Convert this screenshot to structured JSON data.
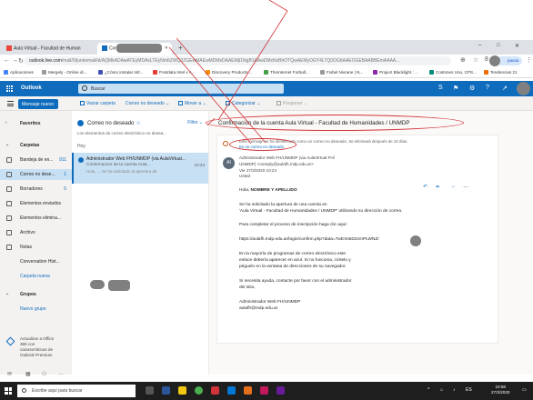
{
  "browser": {
    "tabs": [
      {
        "label": "Aula Virtual - Facultad de Human",
        "close": "✕"
      },
      {
        "label": "Correo",
        "close": "✕"
      }
    ],
    "new_tab": "+",
    "window_controls": [
      "–",
      "□",
      "✕"
    ],
    "url_host": "outlook.live.com",
    "url_rest": "/mail/0/junkemail/id/AQMkADAwATEyMDAxLTEyNmItZWQ2ZGEwMAEwMDMxDAAEMjI1NgB1AAwDMxNzBhOTQwAEMyOGY4LTQ0OGItAAEOGEBAABBEmAAAA...",
    "pause_label": "pausa",
    "bookmarks": [
      "Aplicaciones",
      "Mergely - Online di...",
      "¿Cómo instalar Intl...",
      "Postdata Intel v A...",
      "Discovery Products ...",
      "TheInternet Forball...",
      "Fixbel Nivrane | N...",
      "Project Blacklight : ...",
      "Costones Uno, CPS...",
      "Tendencias 21"
    ]
  },
  "outlook": {
    "brand": "Outlook",
    "search_placeholder": "Buscar",
    "new_message": "Mensaje nuevo",
    "commands": {
      "empty_folder": "Vaciar carpeta",
      "move_to": "Mover a",
      "categorize": "Categorizar",
      "postpone": "Posponer",
      "not_junk": "Correo no deseado"
    },
    "folders": [
      {
        "label": "Favoritos",
        "type": "header"
      },
      {
        "label": "Carpetas",
        "type": "header"
      },
      {
        "label": "Bandeja de en...",
        "count": "911"
      },
      {
        "label": "Correo no dese...",
        "count": "1",
        "selected": true
      },
      {
        "label": "Borradores",
        "count": "5"
      },
      {
        "label": "Elementos enviados"
      },
      {
        "label": "Elementos elimina..."
      },
      {
        "label": "Archivo"
      },
      {
        "label": "Notas"
      },
      {
        "label": "Conversation Hist..."
      },
      {
        "label": "Carpeta nueva",
        "link": true
      },
      {
        "label": "Grupos",
        "type": "header"
      },
      {
        "label": "Nuevo grupo",
        "link": true
      }
    ],
    "upgrade": [
      "Actualizar a Office",
      "365 con",
      "características de",
      "Outlook Premium"
    ]
  },
  "message_list": {
    "title": "Correo no deseado",
    "star": "☆",
    "filter": "Filtro",
    "note": "Los elementos de correo electrónico no desea...",
    "group": "Hoy",
    "item": {
      "sender": "Administrador Web FH/UNMDP (via AulaVirtual...",
      "subject": "Confirmación de la cuenta Aula...",
      "time": "10:24",
      "preview": "Hola, ... Se ha solicitado la apertura de"
    }
  },
  "reading": {
    "subject": "Confirmación de la cuenta Aula Virtual - Facultad de Humanidades / UNMDP",
    "warning": "Este mensaje se ha identificado como un correo no deseado. Se eliminará después de 10 días.",
    "warning_link": "Es un correo no deseado",
    "sender_initials": "AI",
    "from": "Administrador Web FH/UNMDP (via AulaVirtual FH/",
    "from_line2": "UNMDP) <noreply@aulafh.mdp.edu.ar>",
    "date": "Vie 27/3/2020 10:24",
    "to": "Usted",
    "greeting": "Hola, ",
    "name_placeholder": "NOMBRE Y APELLIDO",
    "body": [
      "Se ha solicitado la apertura de una cuenta en",
      "'Aula Virtual - Facultad de Humanidades / UNMDP' utilizando su dirección de correo.",
      "",
      "Para completar el proceso de inscripción haga clic aquí:",
      "",
      "https://aulafh.mdp.edu.ar/login/confirm.php?data=7wEXs6D2zmPLWNZ/",
      "",
      "En la mayoría de programas de correo electrónico este",
      "enlace debería aparecer en azul. Si no funciona, córtelo y",
      "péguelo en la ventana de direcciones de su navegador.",
      "",
      "Si necesita ayuda, contacte por favor con el administrador",
      "del sitio,",
      "",
      "Administrador Web FH/UNMDP",
      "aulafh@mdp.edu.ar"
    ]
  },
  "taskbar": {
    "search_placeholder": "Escribe aquí para buscar",
    "time": "10:58",
    "date": "27/3/2020"
  }
}
